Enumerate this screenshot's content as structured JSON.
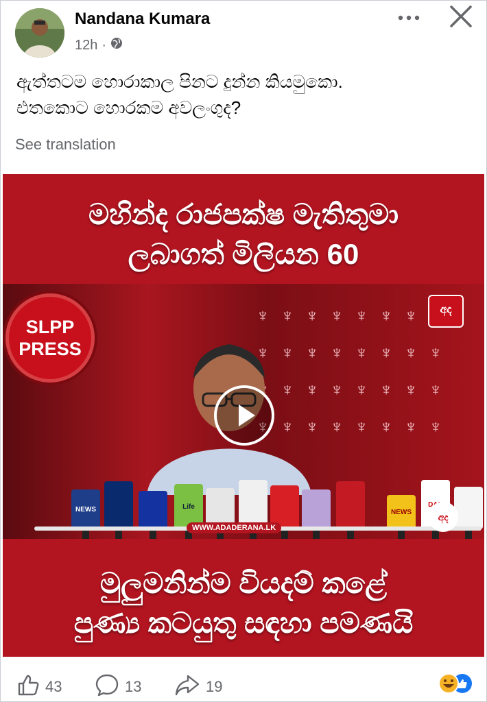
{
  "post": {
    "author": "Nandana Kumara",
    "time": "12h",
    "privacy_icon": "globe-icon",
    "text_line1": "ඇත්තටම හොරාකාල පිනට දුන්න කියමුකො.",
    "text_line2": "එතකොට හොරකම අවලංගුද?",
    "see_translation": "See translation"
  },
  "media": {
    "headline_line1": "මහින්ද රාජපක්ෂ මැතිතුමා",
    "headline_line2": "ලබාගත් මිලියන 60",
    "bottom_line1": "මුලුමනින්ම වියදම් කළේ",
    "bottom_line2": "පුණ්‍ය කටයුතු සඳහා පමණයි",
    "badge_line1": "SLPP",
    "badge_line2": "PRESS",
    "url_text": "WWW.ADADERANA.LK",
    "logo_text": "අද",
    "mic_labels": [
      "NEWS",
      "",
      "",
      "Life",
      "",
      "",
      "",
      "",
      "",
      "NEWS",
      "DAN",
      ""
    ]
  },
  "footer": {
    "likes": "43",
    "comments": "13",
    "shares": "19"
  },
  "colors": {
    "media_red": "#b21420",
    "text_dark": "#050505",
    "text_muted": "#65676b"
  }
}
